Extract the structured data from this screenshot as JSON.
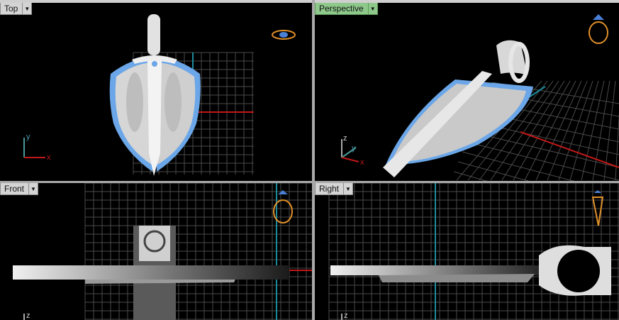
{
  "viewports": {
    "top": {
      "label": "Top",
      "axes": {
        "a": "y",
        "b": "x"
      }
    },
    "perspective": {
      "label": "Perspective",
      "axes": {
        "a": "z",
        "b": "y",
        "c": "x"
      }
    },
    "front": {
      "label": "Front",
      "axes": {
        "a": "z"
      }
    },
    "right": {
      "label": "Right",
      "axes": {
        "a": "z"
      }
    }
  },
  "menu_arrow": "▼",
  "colors": {
    "active_label": "#8ec98b",
    "grid": "#4a4a4a",
    "x_axis": "#c01818",
    "y_axis": "#1c8a9a",
    "gem": "#6aa6e8",
    "gizmo": "#e0902a"
  },
  "icons": [
    "viewcube-ring-icon",
    "dropdown-arrow-icon"
  ]
}
